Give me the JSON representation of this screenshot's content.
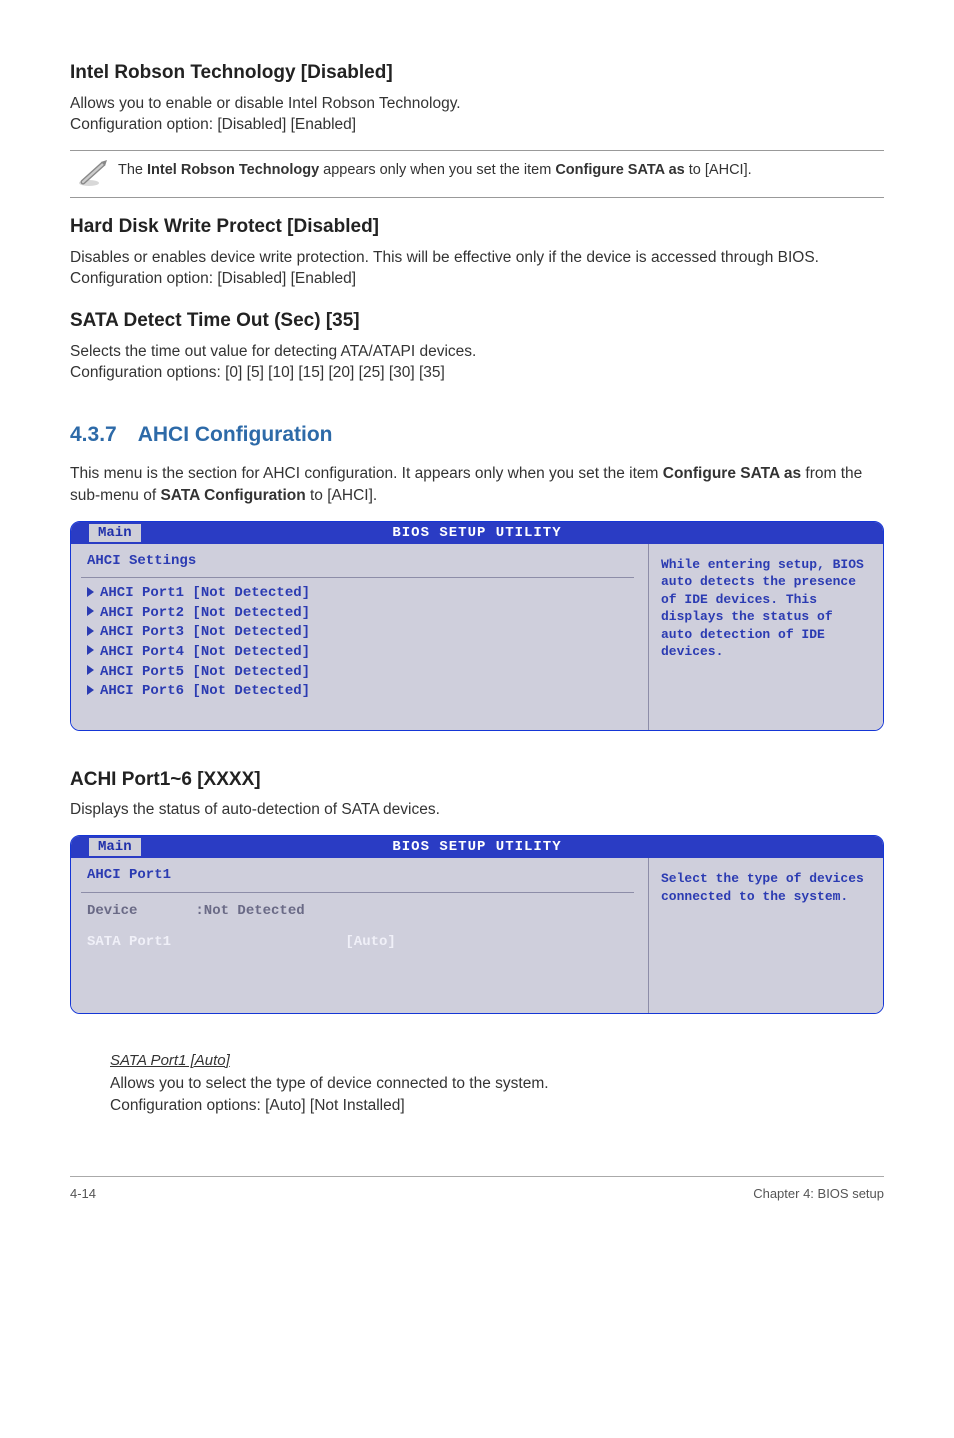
{
  "sections": {
    "robson": {
      "title": "Intel Robson Technology [Disabled]",
      "body": "Allows you to enable or disable Intel Robson Technology.\nConfiguration option: [Disabled] [Enabled]",
      "note_pre": "The ",
      "note_bold1": "Intel Robson Technology",
      "note_mid": " appears only when you set the item ",
      "note_bold2": "Configure SATA as",
      "note_post": " to [AHCI]."
    },
    "hdwp": {
      "title": "Hard Disk Write Protect [Disabled]",
      "body": "Disables or enables device write protection. This will be effective only if the device is accessed through BIOS. Configuration option: [Disabled] [Enabled]"
    },
    "sdto": {
      "title": "SATA Detect Time Out (Sec) [35]",
      "body": "Selects the time out value for detecting ATA/ATAPI devices.\nConfiguration options: [0] [5] [10] [15] [20] [25] [30] [35]"
    },
    "ahci": {
      "heading": "4.3.7 AHCI Configuration",
      "intro_pre": "This menu is the section for AHCI configuration. It appears only when you set the item ",
      "intro_b1": "Configure SATA as",
      "intro_mid": " from the sub-menu of ",
      "intro_b2": "SATA Configuration",
      "intro_post": " to [AHCI]."
    },
    "achi_port": {
      "title": "ACHI Port1~6 [XXXX]",
      "body": "Displays the status of auto-detection of SATA devices."
    },
    "sataport": {
      "title": "SATA Port1 [Auto]",
      "body": "Allows you to select the type of device connected to the system.\nConfiguration options: [Auto] [Not Installed]"
    }
  },
  "bios1": {
    "topbar": "BIOS SETUP UTILITY",
    "tab": "Main",
    "left_title": "AHCI Settings",
    "items": [
      "AHCI Port1 [Not Detected]",
      "AHCI Port2 [Not Detected]",
      "AHCI Port3 [Not Detected]",
      "AHCI Port4 [Not Detected]",
      "AHCI Port5 [Not Detected]",
      "AHCI Port6 [Not Detected]"
    ],
    "help": "While entering setup, BIOS auto detects the presence of IDE devices. This displays the status of auto detection of IDE devices."
  },
  "bios2": {
    "topbar": "BIOS SETUP UTILITY",
    "tab": "Main",
    "left_title": "AHCI Port1",
    "device_label": "Device",
    "device_value": ":Not Detected",
    "field_label": "SATA Port1",
    "field_value": "[Auto]",
    "help": "Select the type of devices connected to the system."
  },
  "footer": {
    "left": "4-14",
    "right": "Chapter 4: BIOS setup"
  }
}
